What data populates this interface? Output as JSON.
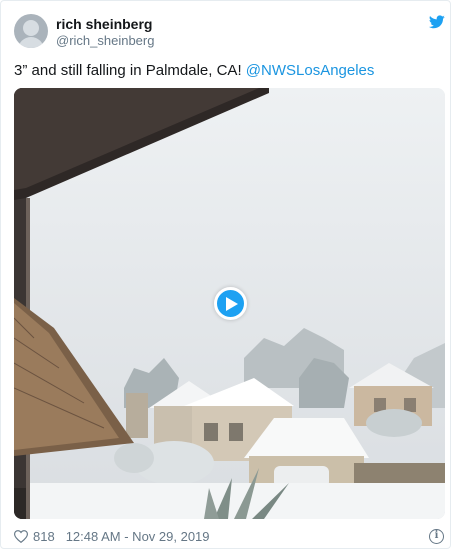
{
  "tweet": {
    "display_name": "rich sheinberg",
    "handle": "@rich_sheinberg",
    "text": "3” and still falling in Palmdale, CA! ",
    "mention": "@NWSLosAngeles",
    "like_count": "818",
    "timestamp": "12:48 AM - Nov 29, 2019"
  },
  "icons": {
    "logo": "twitter-bird-icon",
    "like": "heart-icon",
    "info": "info-icon",
    "play": "play-icon"
  },
  "colors": {
    "brand": "#1da1f2",
    "link": "#1b95e0",
    "muted": "#657786"
  }
}
